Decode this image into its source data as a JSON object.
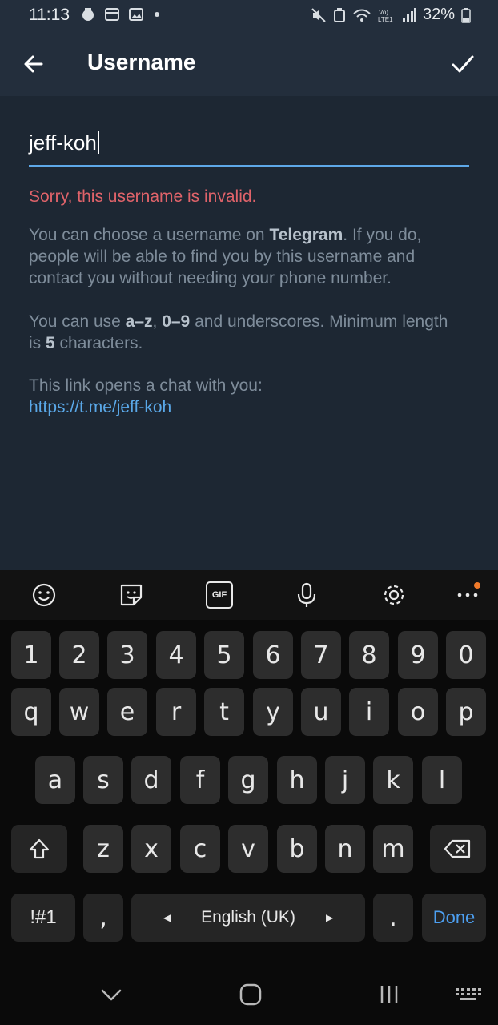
{
  "status_bar": {
    "time": "11:13",
    "battery": "32%",
    "icons": [
      "notification-icon",
      "calendar-icon",
      "gallery-icon",
      "dot-icon",
      "mute-icon",
      "battery-saver-icon",
      "wifi-icon",
      "volte-icon",
      "signal-icon",
      "battery-icon"
    ]
  },
  "appbar": {
    "title": "Username",
    "back_icon": "arrow-left-icon",
    "confirm_icon": "check-icon"
  },
  "form": {
    "username_value": "jeff-koh",
    "error": "Sorry, this username is invalid.",
    "help1": {
      "pre": "You can choose a username on ",
      "bold": "Telegram",
      "post": ". If you do, people will be able to find you by this username and contact you without needing your phone number."
    },
    "help2": {
      "pre": "You can use ",
      "b1": "a–z",
      "mid1": ", ",
      "b2": "0–9",
      "mid2": " and underscores. Minimum length is ",
      "b3": "5",
      "post": " characters."
    },
    "help3": {
      "text": "This link opens a chat with you:",
      "link": "https://t.me/jeff-koh"
    }
  },
  "keyboard": {
    "toolbar": [
      "emoji-icon",
      "sticker-icon",
      "gif-icon",
      "microphone-icon",
      "settings-icon",
      "more-icon"
    ],
    "gif_label": "GIF",
    "row_numbers": [
      "1",
      "2",
      "3",
      "4",
      "5",
      "6",
      "7",
      "8",
      "9",
      "0"
    ],
    "row_q": [
      "q",
      "w",
      "e",
      "r",
      "t",
      "y",
      "u",
      "i",
      "o",
      "p"
    ],
    "row_a": [
      "a",
      "s",
      "d",
      "f",
      "g",
      "h",
      "j",
      "k",
      "l"
    ],
    "row_z": [
      "z",
      "x",
      "c",
      "v",
      "b",
      "n",
      "m"
    ],
    "symbols_label": "!#1",
    "comma_label": ",",
    "space_label": "English (UK)",
    "period_label": ".",
    "done_label": "Done",
    "accent_color": "#4d9ff0"
  },
  "navbar": {
    "icons": [
      "chevron-down-icon",
      "home-icon",
      "recents-icon",
      "keyboard-icon"
    ]
  }
}
